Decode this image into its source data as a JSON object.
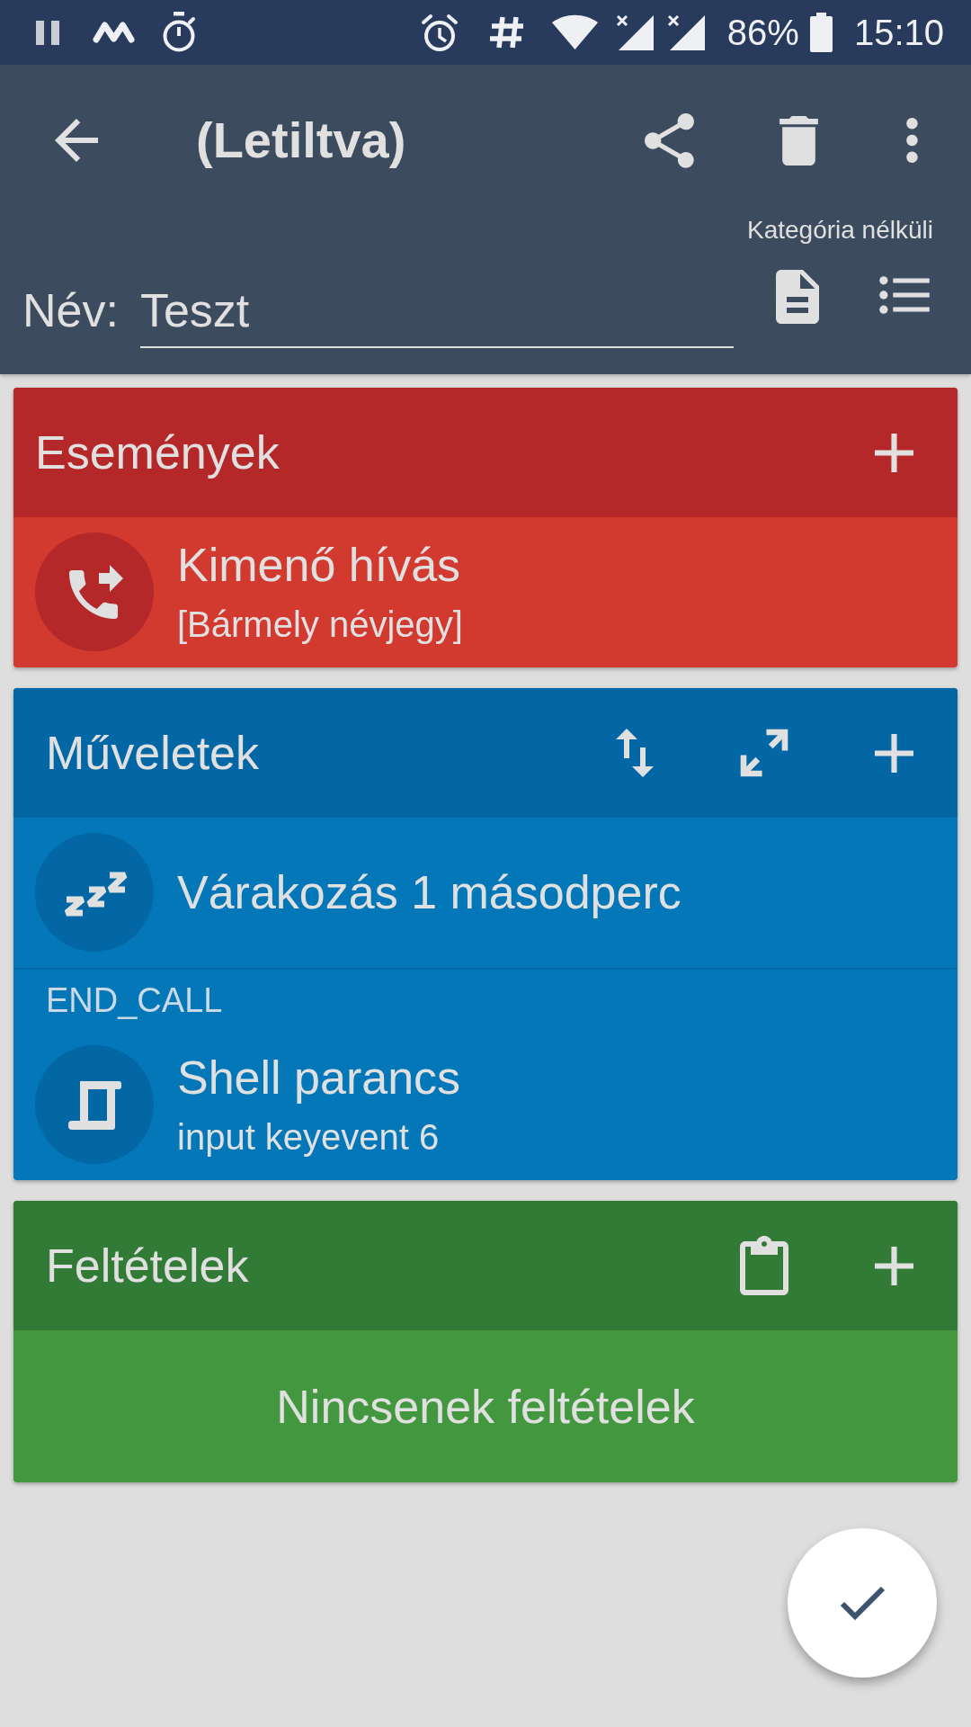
{
  "status_bar": {
    "battery": "86%",
    "time": "15:10"
  },
  "app_bar": {
    "title": "(Letiltva)",
    "category": "Kategória nélküli",
    "name_label": "Név:",
    "name_field": {
      "value": "Teszt"
    }
  },
  "sections": [
    {
      "kind": "events",
      "title": "Események",
      "items": [
        {
          "kind": "outgoing_call",
          "title": "Kimenő hívás",
          "subtitle": "[Bármely névjegy]"
        }
      ]
    },
    {
      "kind": "actions",
      "title": "Műveletek",
      "items": [
        {
          "kind": "wait",
          "title": "Várakozás 1 másodperc"
        },
        {
          "kind": "shell",
          "label": "END_CALL",
          "title": "Shell parancs",
          "subtitle": "input keyevent 6"
        }
      ]
    },
    {
      "kind": "conditions",
      "title": "Feltételek",
      "empty_text": "Nincsenek feltételek"
    }
  ]
}
